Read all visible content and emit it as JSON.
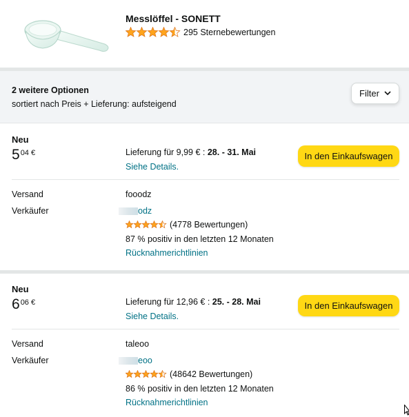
{
  "product": {
    "title": "Messlöffel - SONETT",
    "rating": 4.5,
    "rating_count_text": "295 Sternebewertungen",
    "image_icon": "measuring-spoon-image"
  },
  "options": {
    "title": "2 weitere Optionen",
    "sort_text": "sortiert nach Preis + Lieferung: aufsteigend",
    "filter_label": "Filter"
  },
  "offers": [
    {
      "condition": "Neu",
      "price_whole": "5",
      "price_frac": "04 €",
      "delivery_prefix": "Lieferung für 9,99 € : ",
      "delivery_dates": "28. - 31. Mai",
      "details_label": "Siehe Details.",
      "cart_label": "In den Einkaufswagen",
      "ship_label": "Versand",
      "ship_value": "fooodz",
      "seller_label": "Verkäufer",
      "seller_name_visible": "odz",
      "seller_rating": 4.5,
      "seller_rating_text": "(4778 Bewertungen)",
      "positive_text": "87 % positiv in den letzten 12 Monaten",
      "returns_label": "Rücknahmerichtlinien"
    },
    {
      "condition": "Neu",
      "price_whole": "6",
      "price_frac": "06 €",
      "delivery_prefix": "Lieferung für 12,96 € : ",
      "delivery_dates": "25. - 28. Mai",
      "details_label": "Siehe Details.",
      "cart_label": "In den Einkaufswagen",
      "ship_label": "Versand",
      "ship_value": "taleoo",
      "seller_label": "Verkäufer",
      "seller_name_visible": "eoo",
      "seller_rating": 4.5,
      "seller_rating_text": "(48642 Bewertungen)",
      "positive_text": "86 % positiv in den letzten 12 Monaten",
      "returns_label": "Rücknahmerichtlinien"
    }
  ],
  "colors": {
    "star": "#ffa41c",
    "link": "#007185",
    "cart_button": "#ffd814",
    "section_bg": "#f2f4f6"
  }
}
